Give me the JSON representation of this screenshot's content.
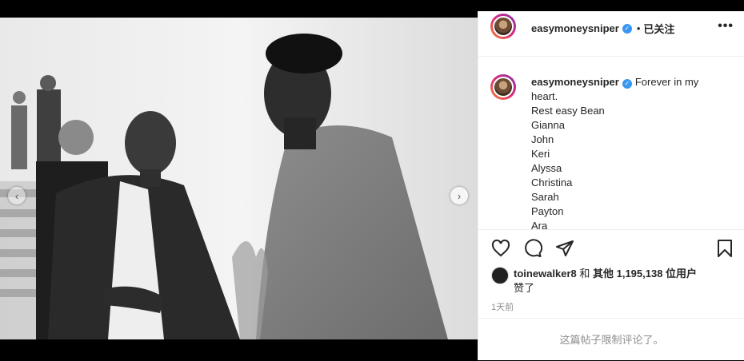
{
  "post": {
    "username": "easymoneysniper",
    "verified_icon": "verified-badge-icon",
    "separator": "•",
    "follow_state": "已关注",
    "more_icon": "more-options-icon"
  },
  "caption": {
    "username": "easymoneysniper",
    "lines": [
      "Forever in my",
      "heart.",
      "Rest easy Bean",
      "Gianna",
      "John",
      "Keri",
      "Alyssa",
      "Christina",
      "Sarah",
      "Payton",
      "Ara"
    ]
  },
  "actions": {
    "icons": [
      "heart-icon",
      "comment-icon",
      "share-icon",
      "bookmark-icon"
    ]
  },
  "likes": {
    "user": "toinewalker8",
    "conj": " 和 ",
    "others_label": "其他 1,195,138 位用户",
    "suffix": "赞了"
  },
  "timestamp": "1天前",
  "comments_disabled": "这篇帖子限制评论了。",
  "carousel": {
    "dot_count": 3,
    "active_index": 1
  },
  "colors": {
    "accent": "#3897f0",
    "text": "#262626",
    "muted": "#8e8e8e",
    "border": "#efefef"
  }
}
